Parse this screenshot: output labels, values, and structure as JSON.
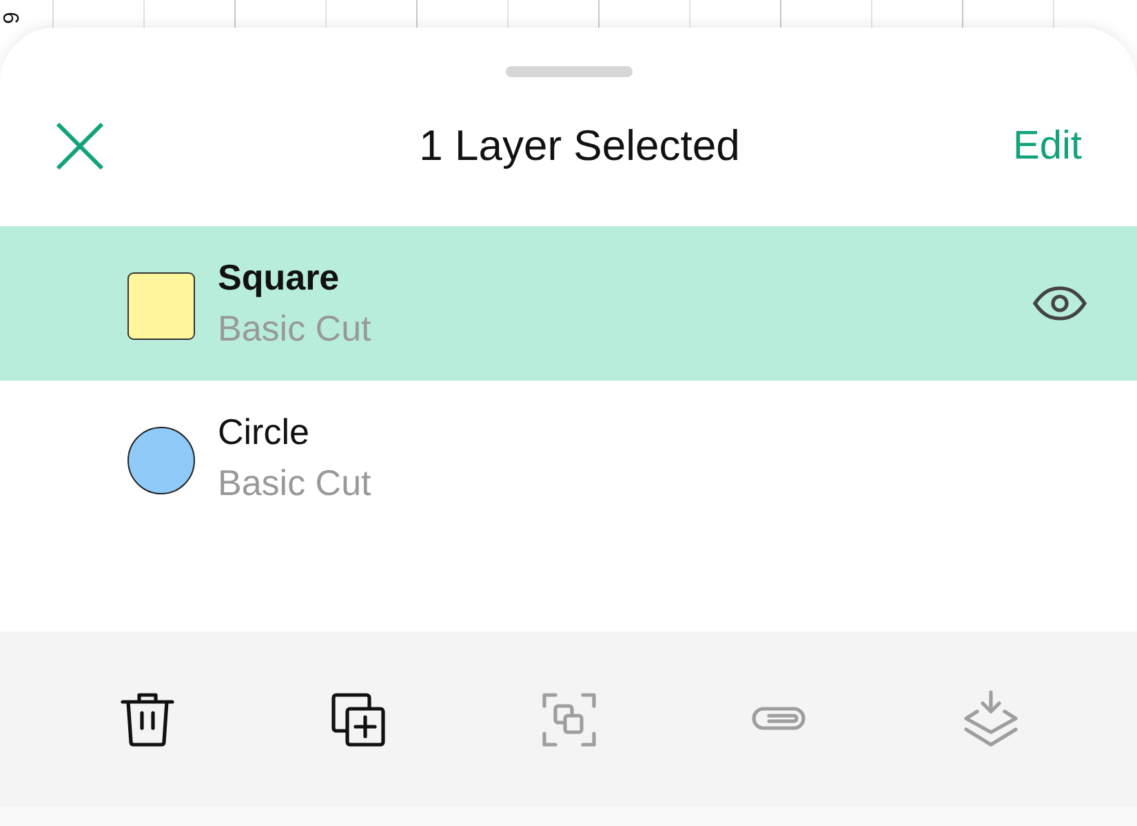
{
  "ruler": {
    "label": "6"
  },
  "header": {
    "title": "1 Layer Selected",
    "action": "Edit"
  },
  "layers": [
    {
      "name": "Square",
      "operation": "Basic Cut",
      "kind": "square",
      "color": "#fff59d",
      "selected": true
    },
    {
      "name": "Circle",
      "operation": "Basic Cut",
      "kind": "circle",
      "color": "#90caf9",
      "selected": false
    }
  ],
  "toolbar": [
    {
      "kind": "delete",
      "disabled": false
    },
    {
      "kind": "duplicate",
      "disabled": false
    },
    {
      "kind": "group",
      "disabled": true
    },
    {
      "kind": "attach",
      "disabled": true
    },
    {
      "kind": "flatten",
      "disabled": true
    }
  ]
}
